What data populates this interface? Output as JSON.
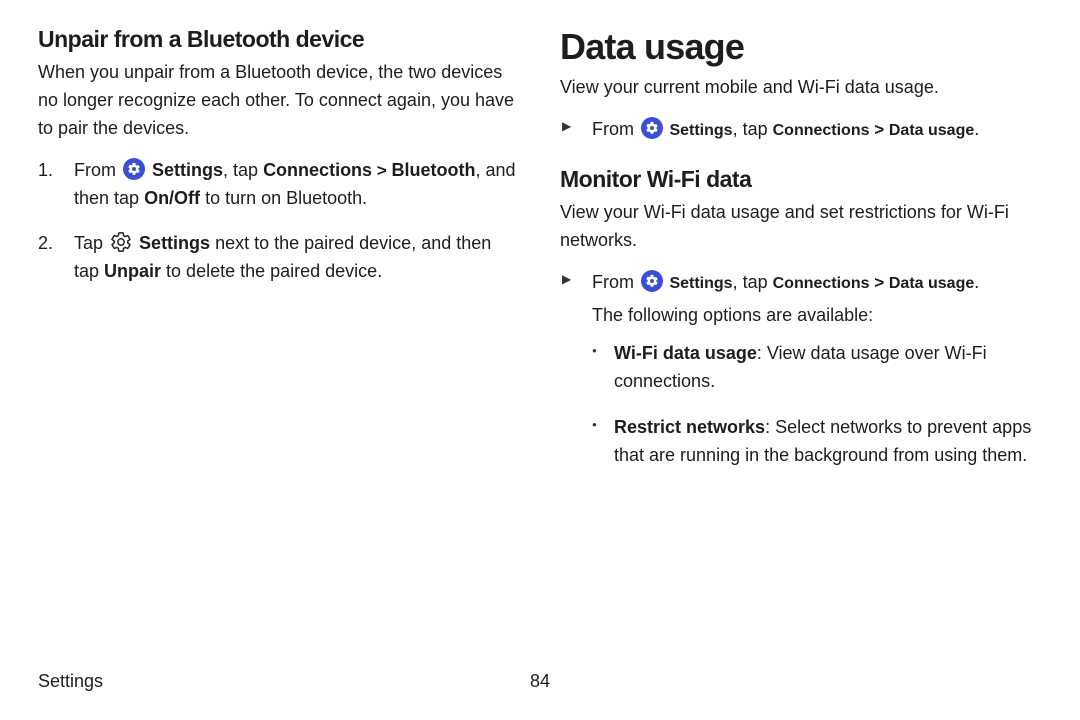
{
  "left": {
    "h2": "Unpair from a Bluetooth device",
    "intro": "When you unpair from a Bluetooth device, the two devices no longer recognize each other. To connect again, you have to pair the devices.",
    "step1": {
      "from": "From ",
      "settings": "Settings",
      "tap": ", tap ",
      "conn": "Connections",
      "gt": " > ",
      "bluetooth": "Bluetooth",
      "trail": ", and then tap ",
      "onoff": "On/Off",
      "end": " to turn on Bluetooth."
    },
    "step2": {
      "a": "Tap ",
      "settings": "Settings",
      "mid": " next to the paired device, and then tap ",
      "unpair": "Unpair",
      "end": " to delete the paired device."
    }
  },
  "right": {
    "h1": "Data usage",
    "intro": "View your current mobile and Wi-Fi data usage.",
    "nav1": {
      "from": "From ",
      "settings": "Settings",
      "tap": ", tap ",
      "conn": "Connections",
      "gt": " > ",
      "du": "Data usage",
      "end": "."
    },
    "h2": "Monitor Wi-Fi data",
    "wifi_intro": "View your Wi-Fi data usage and set restrictions for Wi-Fi networks.",
    "nav2": {
      "from": "From ",
      "settings": "Settings",
      "tap": ", tap ",
      "conn": "Connections",
      "gt": " > ",
      "du": "Data usage",
      "end": "."
    },
    "opts_available": "The following options are available:",
    "opt1": {
      "b": "Wi-Fi data usage",
      "t": ": View data usage over Wi-Fi connections."
    },
    "opt2": {
      "b": "Restrict networks",
      "t": ": Select networks to prevent apps that are running in the background from using them."
    }
  },
  "footer": {
    "section": "Settings",
    "page": "84"
  }
}
